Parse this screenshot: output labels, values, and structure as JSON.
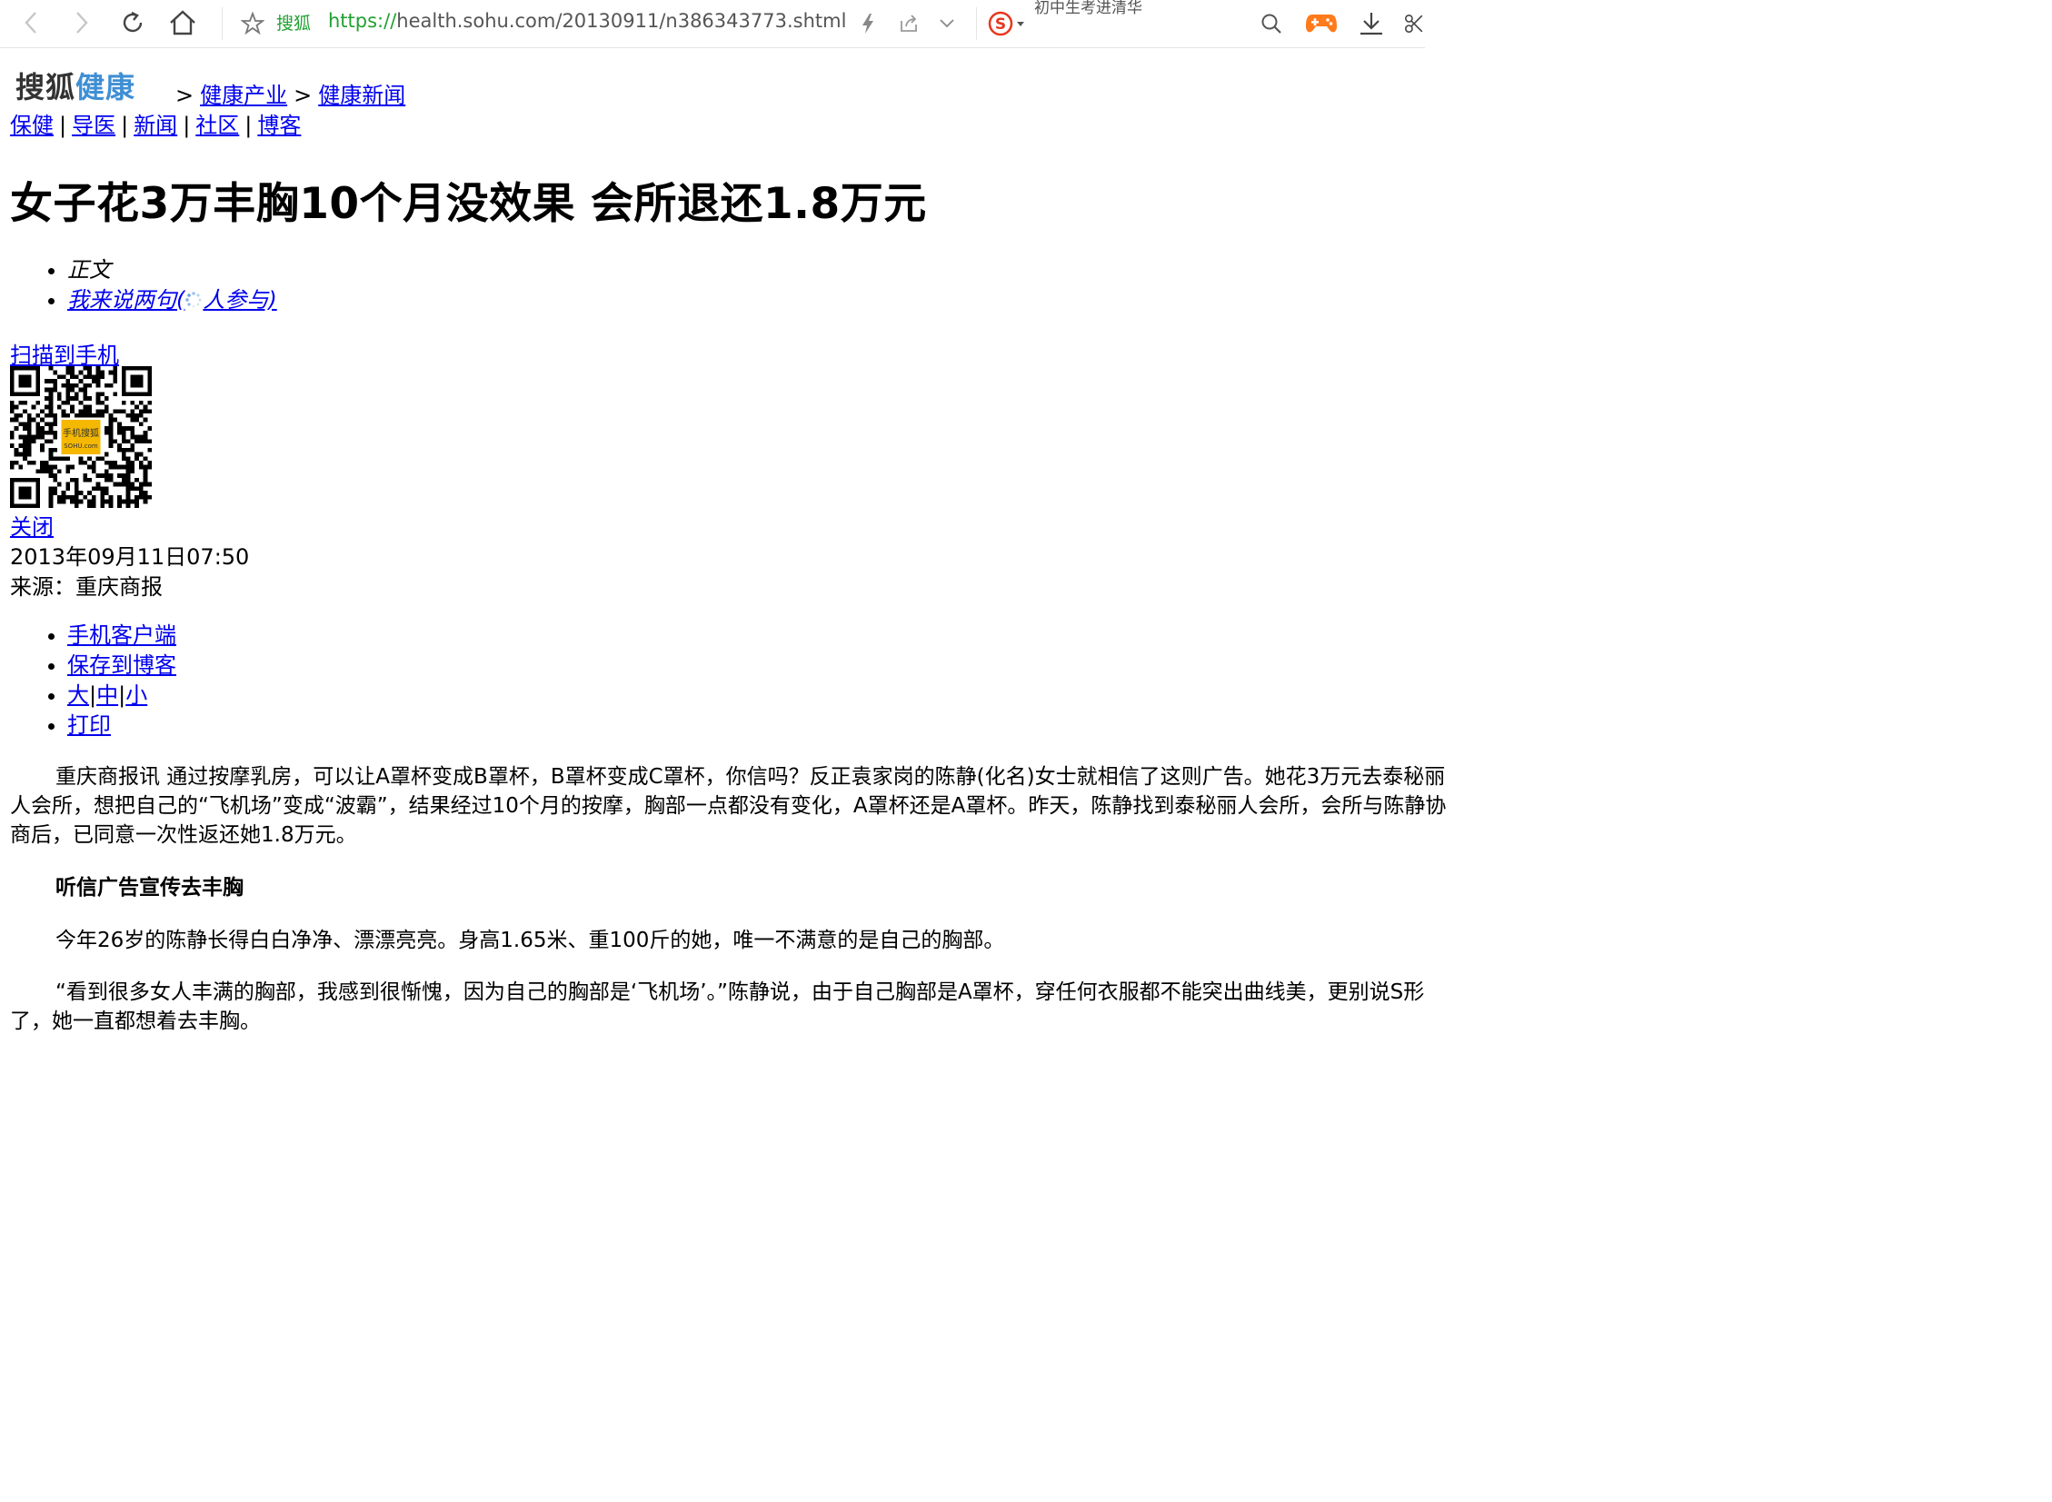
{
  "browser": {
    "site_label": "搜狐",
    "url_scheme": "https://",
    "url_rest": "health.sohu.com/20130911/n386343773.shtml",
    "hot_search": "初中生考进清华",
    "icons": [
      "back-icon",
      "forward-icon",
      "reload-icon",
      "home-icon",
      "star-icon",
      "lightning-icon",
      "share-icon",
      "chevron-down-icon",
      "sogou-icon",
      "search-icon",
      "game-icon",
      "download-icon",
      "scissors-icon"
    ]
  },
  "header": {
    "logo_part1": "搜狐",
    "logo_part2": "健康",
    "breadcrumb_sep": ">",
    "breadcrumb": [
      "健康产业",
      "健康新闻"
    ],
    "nav_sep": "|",
    "nav": [
      "保健",
      "导医",
      "新闻",
      "社区",
      "博客"
    ]
  },
  "article": {
    "title": "女子花3万丰胸10个月没效果 会所退还1.8万元",
    "tab_main": "正文",
    "comment_prefix": "我来说两句(",
    "comment_suffix": "人参与)",
    "scan_label": "扫描到手机",
    "qr_caption_1": "手机搜狐",
    "qr_caption_2": "SOHU.com",
    "close_label": "关闭",
    "date": "2013年09月11日07:50",
    "source": "来源：重庆商报",
    "tools": {
      "mobile_client": "手机客户端",
      "save_blog": "保存到博客",
      "font_large": "大",
      "font_medium": "中",
      "font_small": "小",
      "font_sep": "|",
      "print": "打印"
    },
    "p1": "重庆商报讯 通过按摩乳房，可以让A罩杯变成B罩杯，B罩杯变成C罩杯，你信吗？反正袁家岗的陈静(化名)女士就相信了这则广告。她花3万元去泰秘丽人会所，想把自己的“飞机场”变成“波霸”，结果经过10个月的按摩，胸部一点都没有变化，A罩杯还是A罩杯。昨天，陈静找到泰秘丽人会所，会所与陈静协商后，已同意一次性返还她1.8万元。",
    "subheading": "听信广告宣传去丰胸",
    "p2": "今年26岁的陈静长得白白净净、漂漂亮亮。身高1.65米、重100斤的她，唯一不满意的是自己的胸部。",
    "p3": "“看到很多女人丰满的胸部，我感到很惭愧，因为自己的胸部是‘飞机场’。”陈静说，由于自己胸部是A罩杯，穿任何衣服都不能突出曲线美，更别说S形了，她一直都想着去丰胸。"
  },
  "colors": {
    "link": "#0000ee",
    "url_green": "#21a131",
    "logo_blue": "#3f8fd4",
    "qr_badge": "#f5b800",
    "game_orange": "#ff7a1a",
    "sogou_red": "#e8371e"
  }
}
